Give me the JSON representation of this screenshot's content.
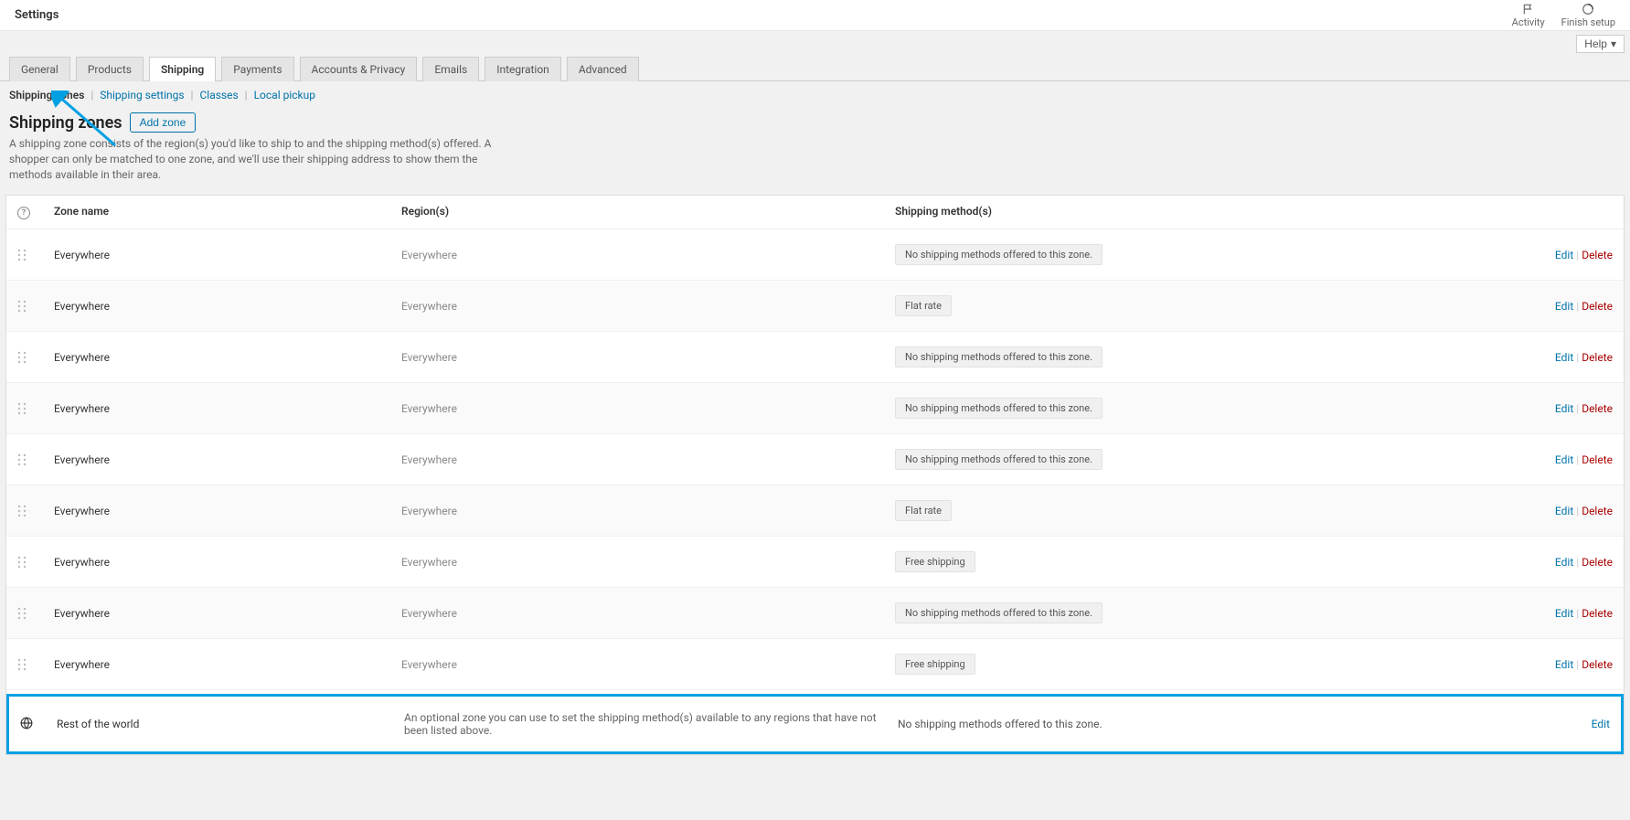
{
  "topbar": {
    "title": "Settings",
    "activity": "Activity",
    "finish_setup": "Finish setup"
  },
  "help_button": "Help",
  "tabs": [
    {
      "label": "General"
    },
    {
      "label": "Products"
    },
    {
      "label": "Shipping",
      "active": true
    },
    {
      "label": "Payments"
    },
    {
      "label": "Accounts & Privacy"
    },
    {
      "label": "Emails"
    },
    {
      "label": "Integration"
    },
    {
      "label": "Advanced"
    }
  ],
  "subnav": [
    {
      "label": "Shipping zones",
      "active": true
    },
    {
      "label": "Shipping settings"
    },
    {
      "label": "Classes"
    },
    {
      "label": "Local pickup"
    }
  ],
  "heading": {
    "title": "Shipping zones",
    "add_button": "Add zone"
  },
  "description": "A shipping zone consists of the region(s) you'd like to ship to and the shipping method(s) offered. A shopper can only be matched to one zone, and we'll use their shipping address to show them the methods available in their area.",
  "table": {
    "headers": {
      "zone": "Zone name",
      "region": "Region(s)",
      "methods": "Shipping method(s)"
    },
    "no_methods": "No shipping methods offered to this zone.",
    "flat_rate": "Flat rate",
    "free_shipping": "Free shipping",
    "edit": "Edit",
    "delete": "Delete",
    "rows": [
      {
        "name": "Everywhere",
        "region": "Everywhere",
        "method": "none"
      },
      {
        "name": "Everywhere",
        "region": "Everywhere",
        "method": "flat"
      },
      {
        "name": "Everywhere",
        "region": "Everywhere",
        "method": "none"
      },
      {
        "name": "Everywhere",
        "region": "Everywhere",
        "method": "none"
      },
      {
        "name": "Everywhere",
        "region": "Everywhere",
        "method": "none"
      },
      {
        "name": "Everywhere",
        "region": "Everywhere",
        "method": "flat"
      },
      {
        "name": "Everywhere",
        "region": "Everywhere",
        "method": "free"
      },
      {
        "name": "Everywhere",
        "region": "Everywhere",
        "method": "none"
      },
      {
        "name": "Everywhere",
        "region": "Everywhere",
        "method": "free"
      }
    ],
    "rest_of_world": {
      "name": "Rest of the world",
      "desc": "An optional zone you can use to set the shipping method(s) available to any regions that have not been listed above.",
      "method": "No shipping methods offered to this zone."
    }
  }
}
